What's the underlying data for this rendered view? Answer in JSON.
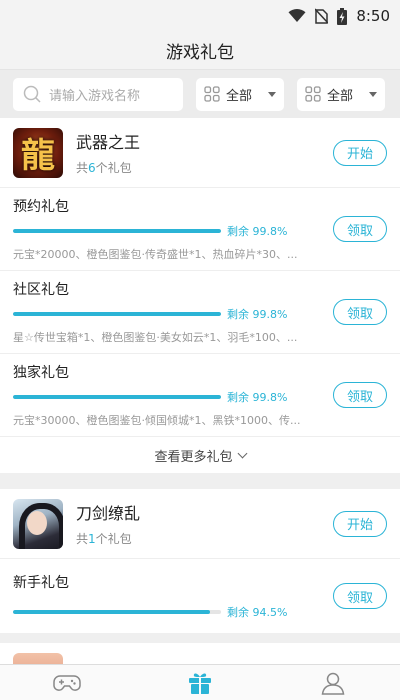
{
  "status_bar": {
    "time": "8:50",
    "icons": [
      "wifi-icon",
      "no-sim-icon",
      "battery-charging-icon"
    ]
  },
  "header": {
    "title": "游戏礼包"
  },
  "filters": {
    "search_placeholder": "请输入游戏名称",
    "dropdown1": "全部",
    "dropdown2": "全部"
  },
  "games": [
    {
      "name": "武器之王",
      "count_prefix": "共",
      "count": "6",
      "count_suffix": "个礼包",
      "icon_char": "龍",
      "action": "开始",
      "gifts": [
        {
          "name": "预约礼包",
          "remain_label": "剩余 99.8%",
          "remain_fraction": 0.998,
          "desc": "元宝*20000、橙色图鉴包·传奇盛世*1、热血碎片*30、...",
          "action": "领取"
        },
        {
          "name": "社区礼包",
          "remain_label": "剩余 99.8%",
          "remain_fraction": 0.998,
          "desc": "星☆传世宝箱*1、橙色图鉴包·美女如云*1、羽毛*100、...",
          "action": "领取"
        },
        {
          "name": "独家礼包",
          "remain_label": "剩余 99.8%",
          "remain_fraction": 0.998,
          "desc": "元宝*30000、橙色图鉴包·倾国倾城*1、黑铁*1000、传...",
          "action": "领取"
        }
      ],
      "more_label": "查看更多礼包"
    },
    {
      "name": "刀剑缭乱",
      "count_prefix": "共",
      "count": "1",
      "count_suffix": "个礼包",
      "action": "开始",
      "gifts": [
        {
          "name": "新手礼包",
          "remain_label": "剩余 94.5%",
          "remain_fraction": 0.945,
          "action": "领取"
        }
      ]
    }
  ],
  "tabbar": {
    "tabs": [
      "gamepad-icon",
      "gift-icon",
      "user-icon"
    ],
    "active": 1,
    "accent": "#2bb4d6"
  },
  "colors": {
    "accent": "#2bb4d6",
    "background": "#efefef",
    "muted_text": "#999999"
  }
}
